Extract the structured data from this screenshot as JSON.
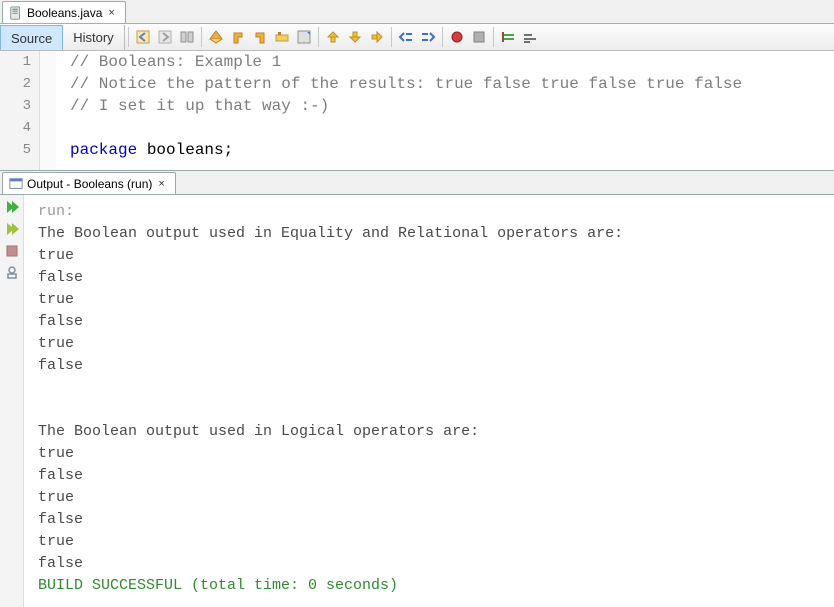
{
  "editorTab": {
    "filename": "Booleans.java",
    "closeGlyph": "×"
  },
  "sourceBar": {
    "source": "Source",
    "history": "History"
  },
  "toolbarIcons": [
    "nav-back-icon",
    "nav-fwd-icon",
    "diff-icon",
    "find-sel-icon",
    "find-prev-icon",
    "find-next-icon",
    "toggle-hl-icon",
    "toggle-mark-icon",
    "prev-bm-icon",
    "next-bm-icon",
    "toggle-bm-icon",
    "shift-left-icon",
    "shift-right-icon",
    "record-macro-icon",
    "stop-macro-icon",
    "comment-icon",
    "uncomment-icon"
  ],
  "code": {
    "lineNumbers": [
      "1",
      "2",
      "3",
      "4",
      "5"
    ],
    "lines": [
      {
        "type": "comment",
        "text": "// Booleans: Example 1"
      },
      {
        "type": "comment",
        "text": "// Notice the pattern of the results: true false true false true false"
      },
      {
        "type": "comment",
        "text": "// I set it up that way :-)"
      },
      {
        "type": "blank",
        "text": ""
      },
      {
        "type": "package",
        "kw": "package",
        "pkg": " booleans;"
      }
    ]
  },
  "outputTab": {
    "title": "Output - Booleans (run)",
    "closeGlyph": "×"
  },
  "output": {
    "runLabel": "run:",
    "section1Header": "The Boolean output used in Equality and Relational operators are:",
    "section1Values": [
      "true",
      "false",
      "true",
      "false",
      "true",
      "false"
    ],
    "section2Header": "The Boolean output used in Logical operators are:",
    "section2Values": [
      "true",
      "false",
      "true",
      "false",
      "true",
      "false"
    ],
    "buildMsg": "BUILD SUCCESSFUL (total time: 0 seconds)"
  }
}
